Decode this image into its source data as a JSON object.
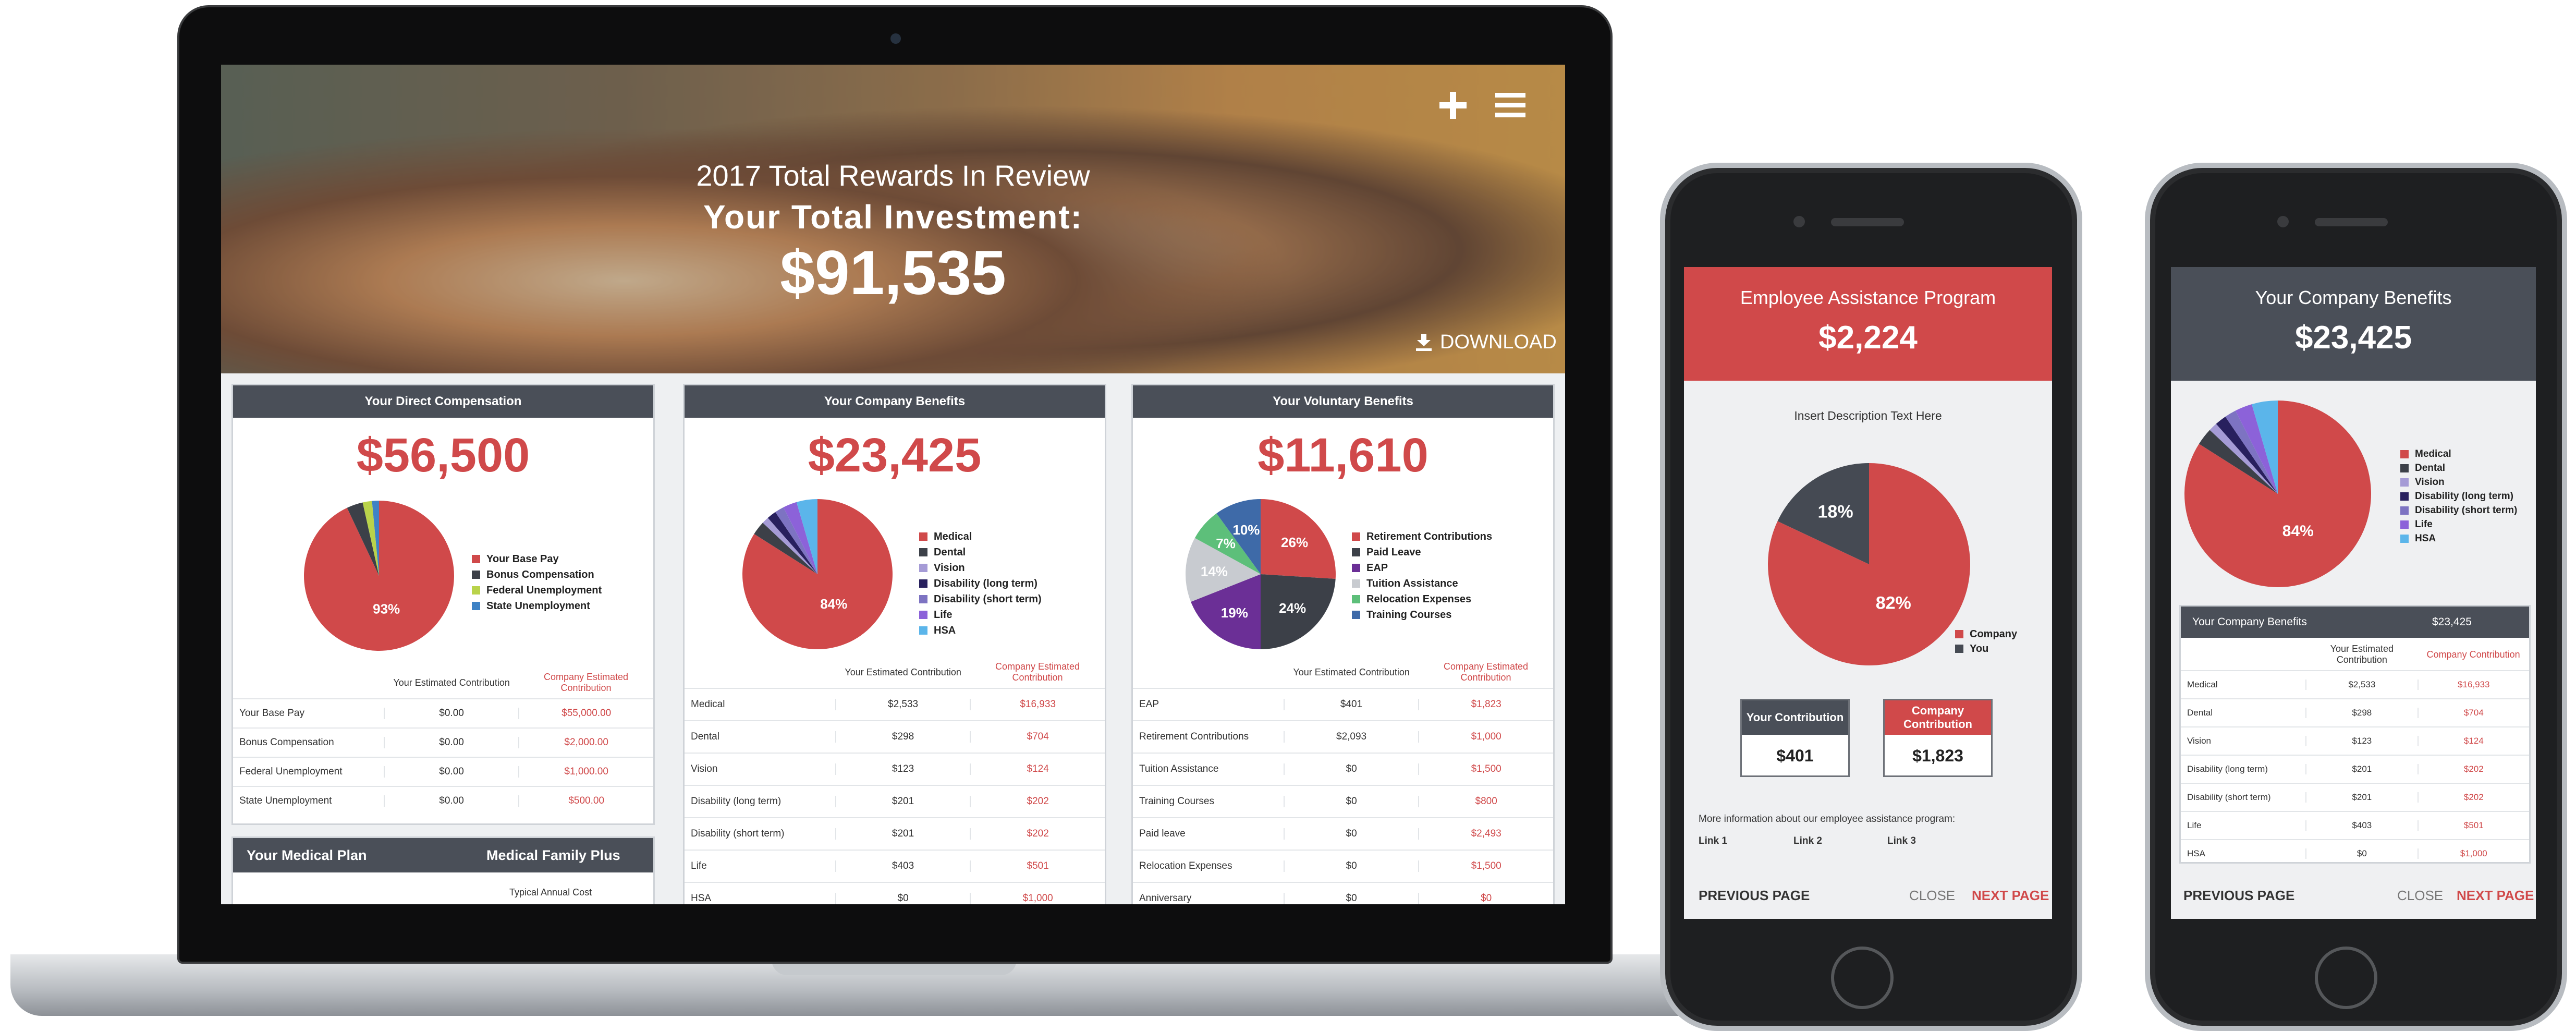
{
  "laptop": {
    "hero": {
      "subtitle": "2017 Total Rewards In Review",
      "title": "Your Total Investment:",
      "amount": "$91,535",
      "download_label": "DOWNLOAD",
      "icons": [
        "plus-icon",
        "menu-icon",
        "download-icon"
      ]
    },
    "direct": {
      "title": "Your Direct Compensation",
      "amount": "$56,500",
      "legend": [
        "Your Base Pay",
        "Bonus Compensation",
        "Federal Unemployment",
        "State Unemployment"
      ],
      "col_headers": [
        "Your Estimated Contribution",
        "Company Estimated Contribution"
      ],
      "rows": [
        [
          "Your Base Pay",
          "$0.00",
          "$55,000.00"
        ],
        [
          "Bonus Compensation",
          "$0.00",
          "$2,000.00"
        ],
        [
          "Federal Unemployment",
          "$0.00",
          "$1,000.00"
        ],
        [
          "State Unemployment",
          "$0.00",
          "$500.00"
        ]
      ]
    },
    "medical": {
      "title": "Your Medical Plan",
      "plan": "Medical Family Plus",
      "typical_cost": "Typical Annual Cost"
    },
    "company": {
      "title": "Your Company Benefits",
      "amount": "$23,425",
      "legend": [
        "Medical",
        "Dental",
        "Vision",
        "Disability (long term)",
        "Disability (short term)",
        "Life",
        "HSA"
      ],
      "col_headers": [
        "Your Estimated Contribution",
        "Company Estimated Contribution"
      ],
      "rows": [
        [
          "Medical",
          "$2,533",
          "$16,933"
        ],
        [
          "Dental",
          "$298",
          "$704"
        ],
        [
          "Vision",
          "$123",
          "$124"
        ],
        [
          "Disability (long term)",
          "$201",
          "$202"
        ],
        [
          "Disability (short term)",
          "$201",
          "$202"
        ],
        [
          "Life",
          "$403",
          "$501"
        ],
        [
          "HSA",
          "$0",
          "$1,000"
        ]
      ]
    },
    "voluntary": {
      "title": "Your Voluntary Benefits",
      "amount": "$11,610",
      "legend": [
        "Retirement Contributions",
        "Paid Leave",
        "EAP",
        "Tuition Assistance",
        "Relocation Expenses",
        "Training Courses"
      ],
      "col_headers": [
        "Your Estimated Contribution",
        "Company Estimated Contribution"
      ],
      "rows": [
        [
          "EAP",
          "$401",
          "$1,823"
        ],
        [
          "Retirement Contributions",
          "$2,093",
          "$1,000"
        ],
        [
          "Tuition Assistance",
          "$0",
          "$1,500"
        ],
        [
          "Training Courses",
          "$0",
          "$800"
        ],
        [
          "Paid leave",
          "$0",
          "$2,493"
        ],
        [
          "Relocation Expenses",
          "$0",
          "$1,500"
        ],
        [
          "Anniversary",
          "$0",
          "$0"
        ]
      ]
    }
  },
  "phone1": {
    "title": "Employee Assistance Program",
    "amount": "$2,224",
    "description": "Insert Description Text Here",
    "legend": [
      "Company",
      "You"
    ],
    "your_contribution_label": "Your Contribution",
    "your_contribution_value": "$401",
    "company_contribution_label": "Company Contribution",
    "company_contribution_value": "$1,823",
    "more_info": "More information about our employee assistance program:",
    "links": [
      "Link 1",
      "Link 2",
      "Link 3"
    ],
    "prev": "PREVIOUS PAGE",
    "close": "CLOSE",
    "next": "NEXT PAGE"
  },
  "phone2": {
    "title": "Your Company Benefits",
    "amount": "$23,425",
    "legend": [
      "Medical",
      "Dental",
      "Vision",
      "Disability (long term)",
      "Disability (short term)",
      "Life",
      "HSA"
    ],
    "table_title": "Your Company Benefits",
    "table_total": "$23,425",
    "col_headers": [
      "Your Estimated Contribution",
      "Company Contribution"
    ],
    "rows": [
      [
        "Medical",
        "$2,533",
        "$16,933"
      ],
      [
        "Dental",
        "$298",
        "$704"
      ],
      [
        "Vision",
        "$123",
        "$124"
      ],
      [
        "Disability (long term)",
        "$201",
        "$202"
      ],
      [
        "Disability (short term)",
        "$201",
        "$202"
      ],
      [
        "Life",
        "$403",
        "$501"
      ],
      [
        "HSA",
        "$0",
        "$1,000"
      ]
    ],
    "prev": "PREVIOUS PAGE",
    "close": "CLOSE",
    "next": "NEXT PAGE"
  },
  "colors": {
    "accent": "#d0494a",
    "header_dark": "#4a4f58"
  },
  "chart_data": [
    {
      "type": "pie",
      "labels": [
        "Your Base Pay",
        "Bonus Compensation",
        "Federal Unemployment",
        "State Unemployment"
      ],
      "values": [
        93,
        3.5,
        2,
        1.5
      ],
      "data_labels": [
        "93%",
        "",
        "",
        ""
      ],
      "colors": [
        "#d0494a",
        "#3c4048",
        "#b9d34a",
        "#3e82c5"
      ]
    },
    {
      "type": "pie",
      "labels": [
        "Medical",
        "Dental",
        "Vision",
        "Disability (long term)",
        "Disability (short term)",
        "Life",
        "HSA"
      ],
      "values": [
        84,
        3,
        1.5,
        2,
        2,
        3,
        4.5
      ],
      "data_labels": [
        "84%",
        "",
        "",
        "",
        "",
        "",
        ""
      ],
      "colors": [
        "#d0494a",
        "#3c4048",
        "#a59bd6",
        "#28205e",
        "#7d73c2",
        "#8c62d9",
        "#5bb5ea"
      ]
    },
    {
      "type": "pie",
      "labels": [
        "Retirement Contributions",
        "Paid Leave",
        "EAP",
        "Tuition Assistance",
        "Relocation Expenses",
        "Training Courses"
      ],
      "values": [
        26,
        24,
        19,
        14,
        7,
        10
      ],
      "data_labels": [
        "26%",
        "24%",
        "19%",
        "14%",
        "7%",
        "10%"
      ],
      "colors": [
        "#d0494a",
        "#3c4048",
        "#6b2f96",
        "#c8cbd0",
        "#5dbf7a",
        "#3e6aa8"
      ]
    },
    {
      "type": "pie",
      "labels": [
        "Company",
        "You"
      ],
      "values": [
        82,
        18
      ],
      "data_labels": [
        "82%",
        "18%"
      ],
      "colors": [
        "#d0494a",
        "#454a53"
      ]
    },
    {
      "type": "pie",
      "labels": [
        "Medical",
        "Dental",
        "Vision",
        "Disability (long term)",
        "Disability (short term)",
        "Life",
        "HSA"
      ],
      "values": [
        84,
        3,
        1.5,
        2,
        2,
        3,
        4.5
      ],
      "data_labels": [
        "84%",
        "",
        "",
        "",
        "",
        "",
        ""
      ],
      "colors": [
        "#d0494a",
        "#3c4048",
        "#a59bd6",
        "#28205e",
        "#7d73c2",
        "#8c62d9",
        "#5bb5ea"
      ]
    }
  ]
}
